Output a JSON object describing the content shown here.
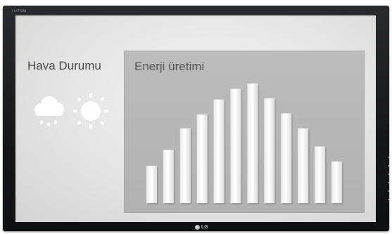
{
  "monitor": {
    "brand_top": "FLATRON",
    "logo_text": "LG"
  },
  "weather": {
    "title": "Hava Durumu",
    "icons": [
      "rain-cloud-icon",
      "sun-icon"
    ]
  },
  "energy": {
    "title": "Enerji üretimi"
  },
  "chart_data": {
    "type": "bar",
    "title": "Enerji üretimi",
    "xlabel": "",
    "ylabel": "",
    "ylim": [
      0,
      100
    ],
    "grid": false,
    "values": [
      35,
      50,
      70,
      83,
      97,
      107,
      112,
      98,
      84,
      70,
      53,
      39
    ]
  }
}
